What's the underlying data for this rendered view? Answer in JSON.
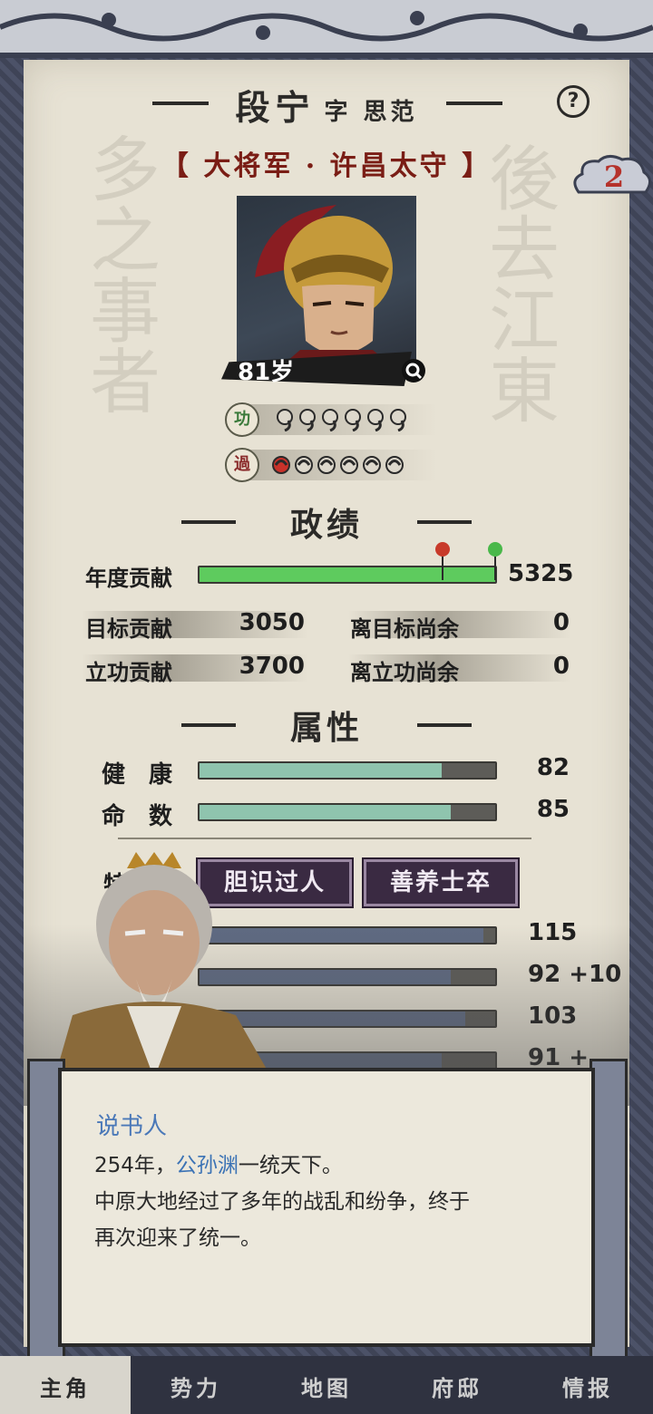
{
  "header": {
    "name": "段宁",
    "courtesy": "字 思范",
    "rank": "【 大将军 · 许昌太守 】",
    "badge": "2"
  },
  "portrait": {
    "age": "81岁"
  },
  "merit": {
    "gong_label": "功",
    "guo_label": "過",
    "gong_count": 6,
    "guo_filled": 1,
    "guo_total": 6
  },
  "governance": {
    "title": "政绩",
    "annual_label": "年度贡献",
    "annual_value": "5325",
    "target_label": "目标贡献",
    "target_value": "3050",
    "target_remain_label": "离目标尚余",
    "target_remain_value": "0",
    "merit_label": "立功贡献",
    "merit_value": "3700",
    "merit_remain_label": "离立功尚余",
    "merit_remain_value": "0"
  },
  "attributes": {
    "title": "属性",
    "health_label": "健　康",
    "health_value": "82",
    "health_fill": 0.82,
    "fate_label": "命　数",
    "fate_value": "85",
    "fate_fill": 0.85
  },
  "specialty": {
    "label": "特长",
    "trait1": "胆识过人",
    "trait2": "善养士卒"
  },
  "stats": [
    {
      "value": "115",
      "fill": 0.96
    },
    {
      "value": "92 +10",
      "fill": 0.85
    },
    {
      "value": "103",
      "fill": 0.9
    },
    {
      "value": "91 +",
      "fill": 0.82
    }
  ],
  "dialog": {
    "speaker": "说书人",
    "line1_prefix": "254年，",
    "line1_name": "公孙渊",
    "line1_suffix": "一统天下。",
    "line2": "中原大地经过了多年的战乱和纷争，终于",
    "line3": "再次迎来了统一。"
  },
  "nav": [
    "主角",
    "势力",
    "地图",
    "府邸",
    "情报"
  ],
  "colors": {
    "green": "#5ecb5e",
    "teal": "#8fc4ae",
    "slate": "#5f6a82",
    "purple": "#3a2a42",
    "accent_red": "#7a1d15"
  }
}
